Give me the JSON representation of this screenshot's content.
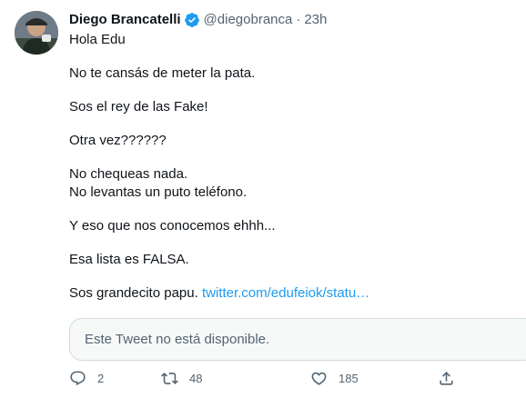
{
  "author": {
    "name": "Diego Brancatelli",
    "handle": "@diegobranca",
    "separator": "·",
    "time": "23h",
    "verified_color": "#1d9bf0"
  },
  "tweet": {
    "lines": {
      "l1": "Hola Edu",
      "l2": "No te cansás de meter la pata.",
      "l3": "Sos el rey de las Fake!",
      "l4": "Otra vez??????",
      "l5a": "No chequeas nada.",
      "l5b": "No levantas un puto teléfono.",
      "l6": "Y eso que nos conocemos ehhh...",
      "l7": "Esa lista es FALSA.",
      "l8_text": "Sos grandecito papu. ",
      "l8_link": "twitter.com/edufeiok/statu…"
    },
    "link_color": "#1d9bf0"
  },
  "quoted": {
    "message": "Este Tweet no está disponible."
  },
  "actions": {
    "reply": {
      "icon": "reply-icon",
      "count": "2"
    },
    "retweet": {
      "icon": "retweet-icon",
      "count": "48"
    },
    "like": {
      "icon": "heart-icon",
      "count": "185"
    },
    "share": {
      "icon": "share-icon"
    }
  }
}
